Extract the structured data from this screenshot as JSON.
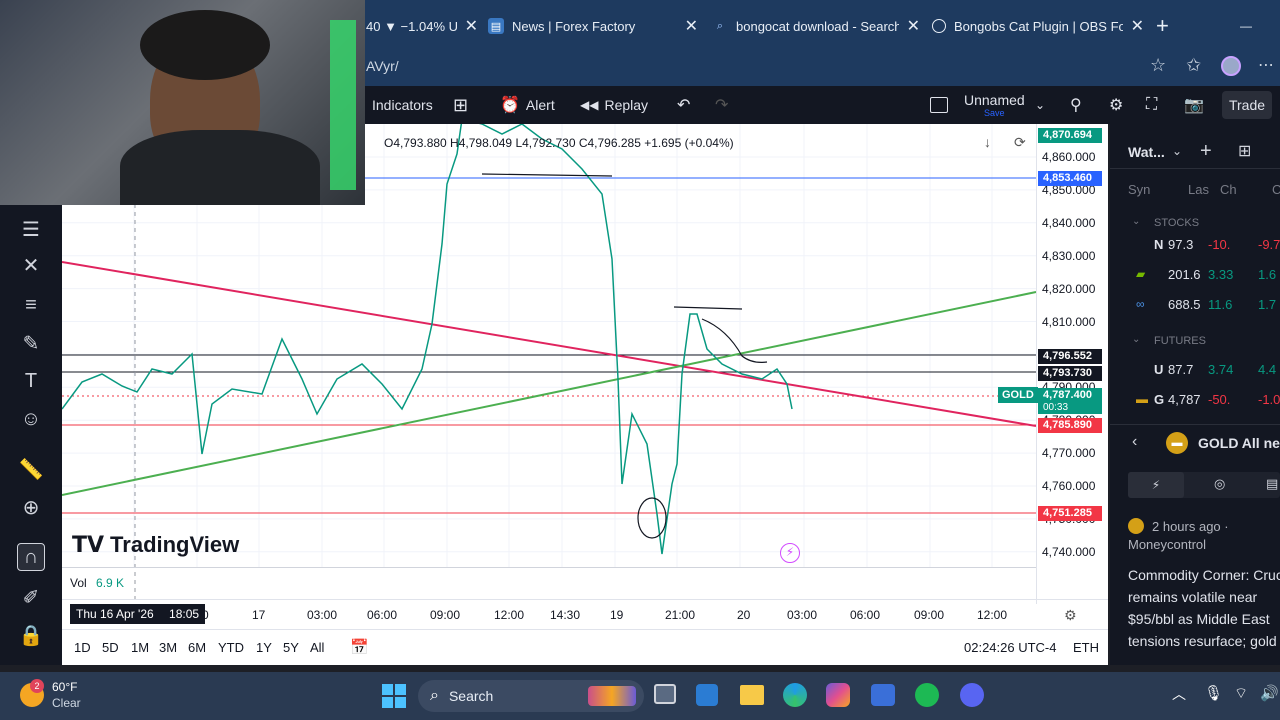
{
  "browser": {
    "tabs": [
      {
        "label": "40 ▼ −1.04% Un",
        "close": "✕"
      },
      {
        "label": "News | Forex Factory",
        "close": "✕"
      },
      {
        "label": "bongocat download - Search",
        "close": "✕"
      },
      {
        "label": "Bongobs Cat Plugin | OBS Foru",
        "close": "✕"
      }
    ],
    "new_tab": "+",
    "minimize": "—",
    "address": "AVyr/"
  },
  "toolbar": {
    "indicators": "Indicators",
    "alert": "Alert",
    "replay": "Replay",
    "layout_name": "Unnamed",
    "layout_save": "Save",
    "trade": "Trade"
  },
  "chart": {
    "ohlc": "O4,793.880 H4,798.049 L4,792.730 C4,796.285 +1.695 (+0.04%)",
    "symbol": "GOLD",
    "countdown": "00:33",
    "watermark": "TradingView",
    "volume_label": "Vol",
    "volume_value": "6.9 K",
    "cursor_date": "Thu 16 Apr '26",
    "cursor_time": "18:05",
    "price_ticks": [
      "4,860.000",
      "4,850.000",
      "4,840.000",
      "4,830.000",
      "4,820.000",
      "4,810.000",
      "4,800.000",
      "4,790.000",
      "4,780.000",
      "4,770.000",
      "4,760.000",
      "4,750.000",
      "4,740.000"
    ],
    "price_labels": [
      {
        "text": "4,870.694",
        "color": "#089981"
      },
      {
        "text": "4,853.460",
        "color": "#2962ff"
      },
      {
        "text": "4,796.552",
        "color": "#131722"
      },
      {
        "text": "4,793.730",
        "color": "#131722"
      },
      {
        "text": "4,787.400",
        "color": "#089981"
      },
      {
        "text": "4,785.890",
        "color": "#f23645"
      },
      {
        "text": "4,751.285",
        "color": "#f23645"
      }
    ],
    "time_ticks": [
      "0",
      "17",
      "03:00",
      "06:00",
      "09:00",
      "12:00",
      "14:30",
      "19",
      "21:00",
      "20",
      "03:00",
      "06:00",
      "09:00",
      "12:00"
    ],
    "ranges": [
      "1D",
      "5D",
      "1M",
      "3M",
      "6M",
      "YTD",
      "1Y",
      "5Y",
      "All"
    ],
    "clock": "02:24:26 UTC-4",
    "session": "ETH"
  },
  "watchlist": {
    "title": "Wat...",
    "columns": [
      "Syn",
      "Las",
      "Ch",
      "Ch"
    ],
    "section_stocks": "STOCKS",
    "stocks": [
      {
        "sym": "N",
        "last": "97.3",
        "chg": "-10.",
        "chgp": "-9.7",
        "color": "#f23645"
      },
      {
        "sym": "",
        "last": "201.6",
        "chg": "3.33",
        "chgp": "1.6",
        "color": "#089981"
      },
      {
        "sym": "",
        "last": "688.5",
        "chg": "11.6",
        "chgp": "1.7",
        "color": "#089981"
      }
    ],
    "section_futures": "FUTURES",
    "futures": [
      {
        "sym": "U",
        "last": "87.7",
        "chg": "3.74",
        "chgp": "4.4",
        "color": "#089981"
      },
      {
        "sym": "G",
        "last": "4,787",
        "chg": "-50.",
        "chgp": "-1.0",
        "color": "#f23645"
      }
    ],
    "news_header": "GOLD All nev",
    "news_time": "2 hours ago ·",
    "news_source": "Moneycontrol",
    "news_headline": "Commodity Corner: Cruc remains volatile near $95/bbl as Middle East tensions resurface; gold"
  },
  "taskbar": {
    "weather_temp": "60°F",
    "weather_desc": "Clear",
    "weather_badge": "2",
    "search": "Search"
  }
}
